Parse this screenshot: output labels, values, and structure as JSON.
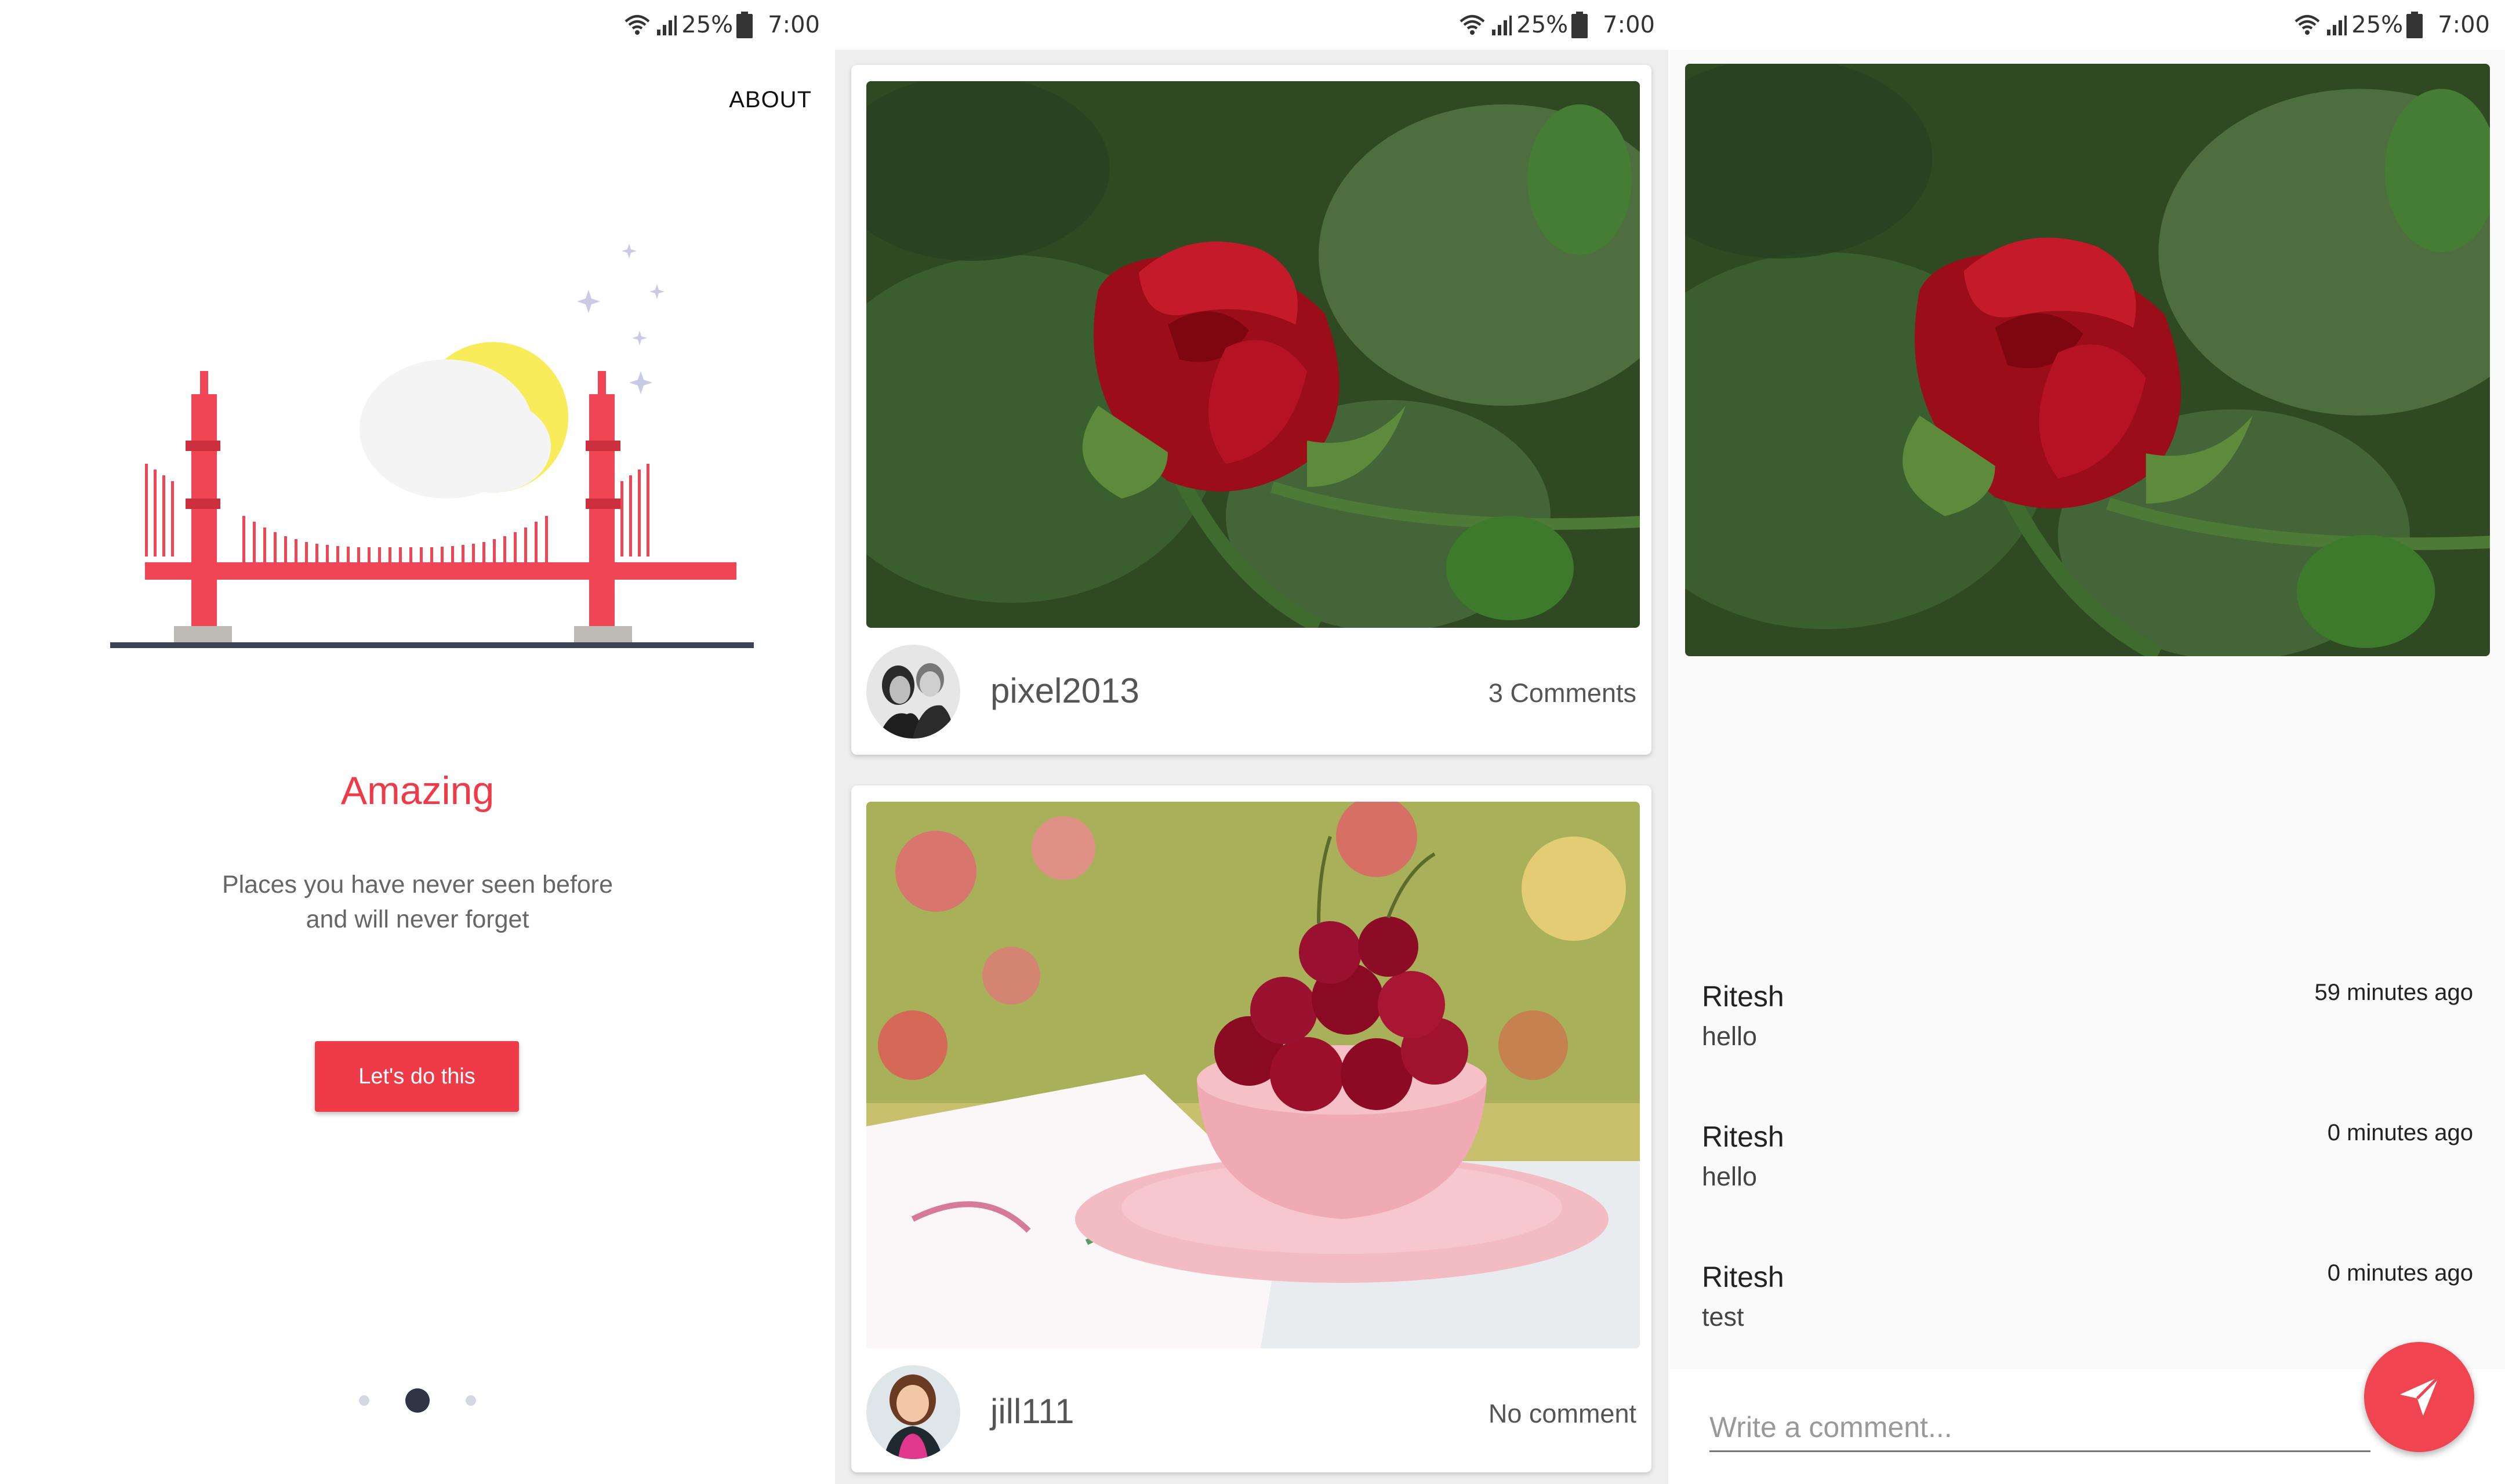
{
  "status_bar": {
    "battery": "25%",
    "time": "7:00"
  },
  "onboarding": {
    "about_label": "ABOUT",
    "title": "Amazing",
    "subtitle_line1": "Places you have never seen before",
    "subtitle_line2": "and will never forget",
    "cta_label": "Let's do this",
    "page_indicator": {
      "pages": 3,
      "active": 2
    },
    "accent_color": "#ee3b47"
  },
  "feed": {
    "posts": [
      {
        "author": "pixel2013",
        "comments": "3 Comments",
        "photo": "red-rose"
      },
      {
        "author": "jill111",
        "comments": "No comment",
        "photo": "cherries-bowl"
      }
    ]
  },
  "detail": {
    "photo": "red-rose",
    "comments": [
      {
        "name": "Ritesh",
        "text": "hello",
        "time": "59 minutes ago"
      },
      {
        "name": "Ritesh",
        "text": "hello",
        "time": "0 minutes ago"
      },
      {
        "name": "Ritesh",
        "text": "test",
        "time": "0 minutes ago"
      }
    ],
    "input_placeholder": "Write a comment...",
    "send_icon": "send-icon"
  }
}
